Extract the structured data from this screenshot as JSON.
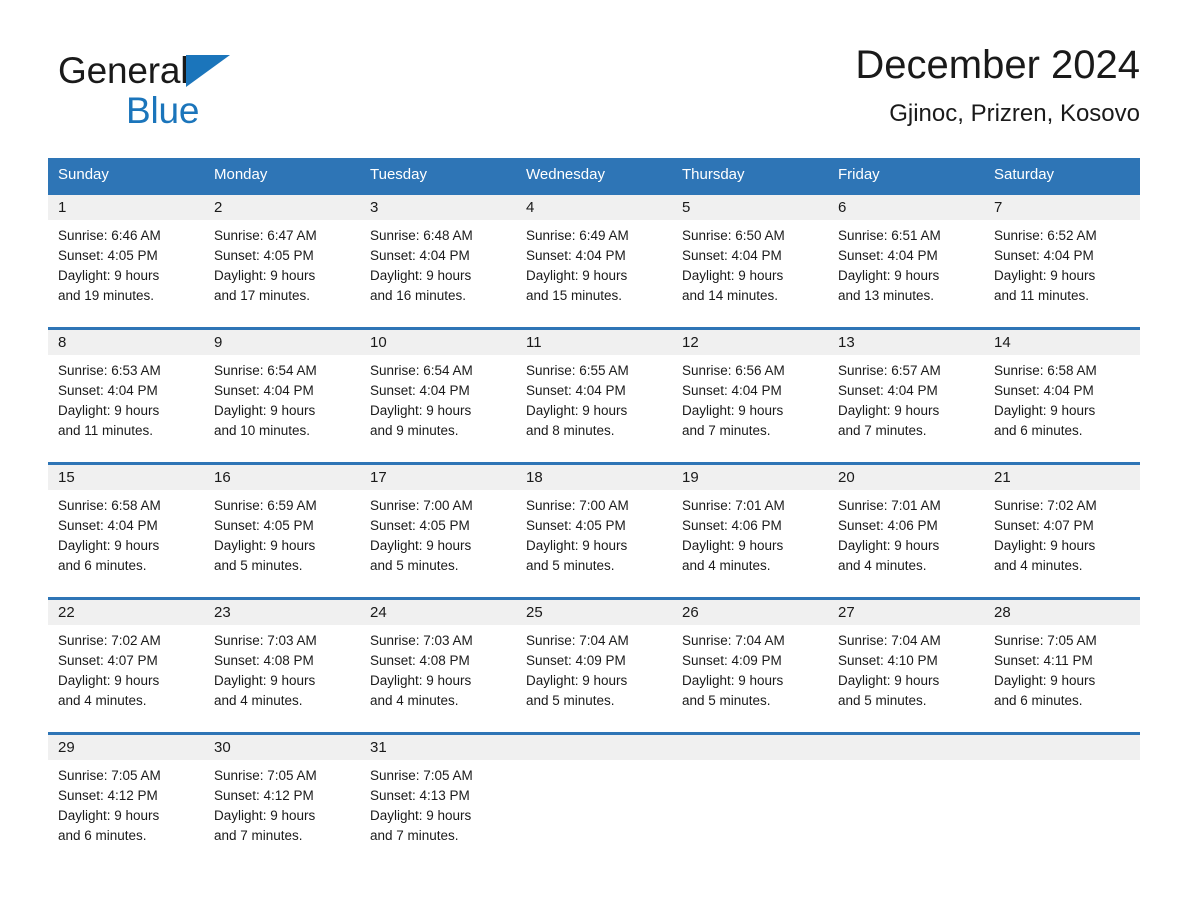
{
  "brand": {
    "name_part1": "General",
    "name_part2": "Blue",
    "triangle_color": "#1b75bb",
    "text_color": "#1a1a1a"
  },
  "header": {
    "title": "December 2024",
    "subtitle": "Gjinoc, Prizren, Kosovo"
  },
  "theme": {
    "header_bg": "#2e75b6",
    "header_text": "#ffffff",
    "daynum_bg": "#f0f0f0",
    "row_border": "#2e75b6",
    "page_bg": "#ffffff",
    "body_text": "#1a1a1a"
  },
  "weekday_headers": [
    "Sunday",
    "Monday",
    "Tuesday",
    "Wednesday",
    "Thursday",
    "Friday",
    "Saturday"
  ],
  "weeks": [
    [
      {
        "day": "1",
        "sunrise": "Sunrise: 6:46 AM",
        "sunset": "Sunset: 4:05 PM",
        "daylight_line1": "Daylight: 9 hours",
        "daylight_line2": "and 19 minutes."
      },
      {
        "day": "2",
        "sunrise": "Sunrise: 6:47 AM",
        "sunset": "Sunset: 4:05 PM",
        "daylight_line1": "Daylight: 9 hours",
        "daylight_line2": "and 17 minutes."
      },
      {
        "day": "3",
        "sunrise": "Sunrise: 6:48 AM",
        "sunset": "Sunset: 4:04 PM",
        "daylight_line1": "Daylight: 9 hours",
        "daylight_line2": "and 16 minutes."
      },
      {
        "day": "4",
        "sunrise": "Sunrise: 6:49 AM",
        "sunset": "Sunset: 4:04 PM",
        "daylight_line1": "Daylight: 9 hours",
        "daylight_line2": "and 15 minutes."
      },
      {
        "day": "5",
        "sunrise": "Sunrise: 6:50 AM",
        "sunset": "Sunset: 4:04 PM",
        "daylight_line1": "Daylight: 9 hours",
        "daylight_line2": "and 14 minutes."
      },
      {
        "day": "6",
        "sunrise": "Sunrise: 6:51 AM",
        "sunset": "Sunset: 4:04 PM",
        "daylight_line1": "Daylight: 9 hours",
        "daylight_line2": "and 13 minutes."
      },
      {
        "day": "7",
        "sunrise": "Sunrise: 6:52 AM",
        "sunset": "Sunset: 4:04 PM",
        "daylight_line1": "Daylight: 9 hours",
        "daylight_line2": "and 11 minutes."
      }
    ],
    [
      {
        "day": "8",
        "sunrise": "Sunrise: 6:53 AM",
        "sunset": "Sunset: 4:04 PM",
        "daylight_line1": "Daylight: 9 hours",
        "daylight_line2": "and 11 minutes."
      },
      {
        "day": "9",
        "sunrise": "Sunrise: 6:54 AM",
        "sunset": "Sunset: 4:04 PM",
        "daylight_line1": "Daylight: 9 hours",
        "daylight_line2": "and 10 minutes."
      },
      {
        "day": "10",
        "sunrise": "Sunrise: 6:54 AM",
        "sunset": "Sunset: 4:04 PM",
        "daylight_line1": "Daylight: 9 hours",
        "daylight_line2": "and 9 minutes."
      },
      {
        "day": "11",
        "sunrise": "Sunrise: 6:55 AM",
        "sunset": "Sunset: 4:04 PM",
        "daylight_line1": "Daylight: 9 hours",
        "daylight_line2": "and 8 minutes."
      },
      {
        "day": "12",
        "sunrise": "Sunrise: 6:56 AM",
        "sunset": "Sunset: 4:04 PM",
        "daylight_line1": "Daylight: 9 hours",
        "daylight_line2": "and 7 minutes."
      },
      {
        "day": "13",
        "sunrise": "Sunrise: 6:57 AM",
        "sunset": "Sunset: 4:04 PM",
        "daylight_line1": "Daylight: 9 hours",
        "daylight_line2": "and 7 minutes."
      },
      {
        "day": "14",
        "sunrise": "Sunrise: 6:58 AM",
        "sunset": "Sunset: 4:04 PM",
        "daylight_line1": "Daylight: 9 hours",
        "daylight_line2": "and 6 minutes."
      }
    ],
    [
      {
        "day": "15",
        "sunrise": "Sunrise: 6:58 AM",
        "sunset": "Sunset: 4:04 PM",
        "daylight_line1": "Daylight: 9 hours",
        "daylight_line2": "and 6 minutes."
      },
      {
        "day": "16",
        "sunrise": "Sunrise: 6:59 AM",
        "sunset": "Sunset: 4:05 PM",
        "daylight_line1": "Daylight: 9 hours",
        "daylight_line2": "and 5 minutes."
      },
      {
        "day": "17",
        "sunrise": "Sunrise: 7:00 AM",
        "sunset": "Sunset: 4:05 PM",
        "daylight_line1": "Daylight: 9 hours",
        "daylight_line2": "and 5 minutes."
      },
      {
        "day": "18",
        "sunrise": "Sunrise: 7:00 AM",
        "sunset": "Sunset: 4:05 PM",
        "daylight_line1": "Daylight: 9 hours",
        "daylight_line2": "and 5 minutes."
      },
      {
        "day": "19",
        "sunrise": "Sunrise: 7:01 AM",
        "sunset": "Sunset: 4:06 PM",
        "daylight_line1": "Daylight: 9 hours",
        "daylight_line2": "and 4 minutes."
      },
      {
        "day": "20",
        "sunrise": "Sunrise: 7:01 AM",
        "sunset": "Sunset: 4:06 PM",
        "daylight_line1": "Daylight: 9 hours",
        "daylight_line2": "and 4 minutes."
      },
      {
        "day": "21",
        "sunrise": "Sunrise: 7:02 AM",
        "sunset": "Sunset: 4:07 PM",
        "daylight_line1": "Daylight: 9 hours",
        "daylight_line2": "and 4 minutes."
      }
    ],
    [
      {
        "day": "22",
        "sunrise": "Sunrise: 7:02 AM",
        "sunset": "Sunset: 4:07 PM",
        "daylight_line1": "Daylight: 9 hours",
        "daylight_line2": "and 4 minutes."
      },
      {
        "day": "23",
        "sunrise": "Sunrise: 7:03 AM",
        "sunset": "Sunset: 4:08 PM",
        "daylight_line1": "Daylight: 9 hours",
        "daylight_line2": "and 4 minutes."
      },
      {
        "day": "24",
        "sunrise": "Sunrise: 7:03 AM",
        "sunset": "Sunset: 4:08 PM",
        "daylight_line1": "Daylight: 9 hours",
        "daylight_line2": "and 4 minutes."
      },
      {
        "day": "25",
        "sunrise": "Sunrise: 7:04 AM",
        "sunset": "Sunset: 4:09 PM",
        "daylight_line1": "Daylight: 9 hours",
        "daylight_line2": "and 5 minutes."
      },
      {
        "day": "26",
        "sunrise": "Sunrise: 7:04 AM",
        "sunset": "Sunset: 4:09 PM",
        "daylight_line1": "Daylight: 9 hours",
        "daylight_line2": "and 5 minutes."
      },
      {
        "day": "27",
        "sunrise": "Sunrise: 7:04 AM",
        "sunset": "Sunset: 4:10 PM",
        "daylight_line1": "Daylight: 9 hours",
        "daylight_line2": "and 5 minutes."
      },
      {
        "day": "28",
        "sunrise": "Sunrise: 7:05 AM",
        "sunset": "Sunset: 4:11 PM",
        "daylight_line1": "Daylight: 9 hours",
        "daylight_line2": "and 6 minutes."
      }
    ],
    [
      {
        "day": "29",
        "sunrise": "Sunrise: 7:05 AM",
        "sunset": "Sunset: 4:12 PM",
        "daylight_line1": "Daylight: 9 hours",
        "daylight_line2": "and 6 minutes."
      },
      {
        "day": "30",
        "sunrise": "Sunrise: 7:05 AM",
        "sunset": "Sunset: 4:12 PM",
        "daylight_line1": "Daylight: 9 hours",
        "daylight_line2": "and 7 minutes."
      },
      {
        "day": "31",
        "sunrise": "Sunrise: 7:05 AM",
        "sunset": "Sunset: 4:13 PM",
        "daylight_line1": "Daylight: 9 hours",
        "daylight_line2": "and 7 minutes."
      },
      {
        "day": "",
        "sunrise": "",
        "sunset": "",
        "daylight_line1": "",
        "daylight_line2": ""
      },
      {
        "day": "",
        "sunrise": "",
        "sunset": "",
        "daylight_line1": "",
        "daylight_line2": ""
      },
      {
        "day": "",
        "sunrise": "",
        "sunset": "",
        "daylight_line1": "",
        "daylight_line2": ""
      },
      {
        "day": "",
        "sunrise": "",
        "sunset": "",
        "daylight_line1": "",
        "daylight_line2": ""
      }
    ]
  ]
}
